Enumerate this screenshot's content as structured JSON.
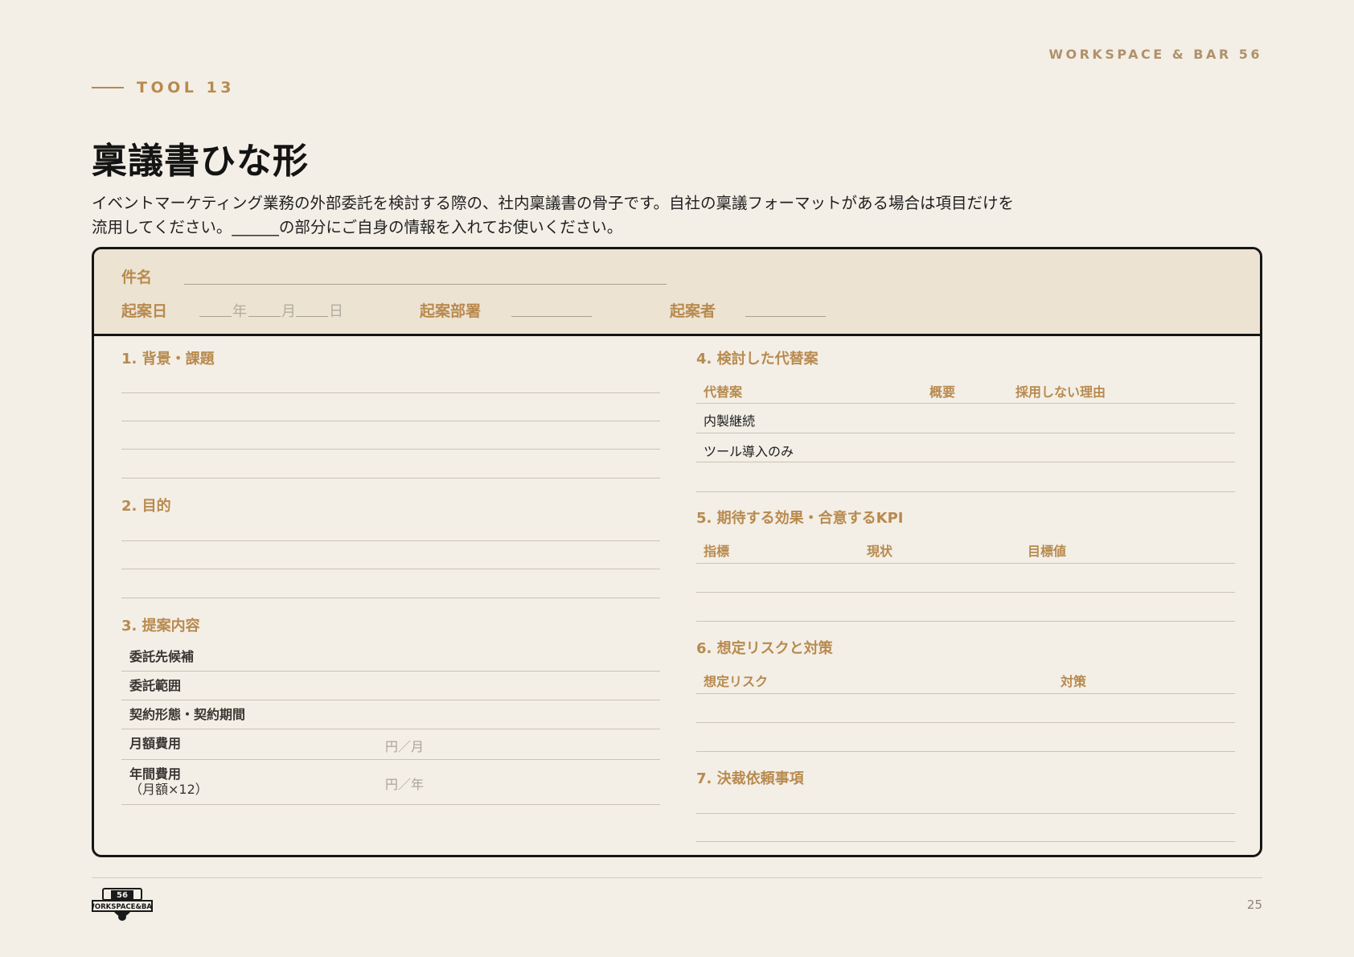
{
  "header": {
    "brand": "WORKSPACE & BAR 56",
    "tool_label": "TOOL 13",
    "title": "稟議書ひな形",
    "intro_line1": "イベントマーケティング業務の外部委託を検討する際の、社内稟議書の骨子です。自社の稟議フォーマットがある場合は項目だけを",
    "intro_line2": "流用してください。______の部分にご自身の情報を入れてお使いください。"
  },
  "form_header": {
    "subject_label": "件名",
    "date_label": "起案日",
    "year": "年",
    "month": "月",
    "day": "日",
    "dept_label": "起案部署",
    "author_label": "起案者"
  },
  "sections": {
    "s1": "1. 背景・課題",
    "s2": "2. 目的",
    "s3": {
      "title": "3. 提案内容",
      "rows": [
        {
          "label": "委託先候補",
          "unit": ""
        },
        {
          "label": "委託範囲",
          "unit": ""
        },
        {
          "label": "契約形態・契約期間",
          "unit": ""
        },
        {
          "label": "月額費用",
          "unit": "円／月"
        },
        {
          "label": "年間費用",
          "label2": "（月額×12）",
          "unit": "円／年"
        }
      ]
    },
    "s4": {
      "title": "4. 検討した代替案",
      "headers": [
        "代替案",
        "概要",
        "採用しない理由"
      ],
      "rows": [
        "内製継続",
        "ツール導入のみ",
        ""
      ]
    },
    "s5": {
      "title": "5. 期待する効果・合意するKPI",
      "headers": [
        "指標",
        "現状",
        "目標値"
      ]
    },
    "s6": {
      "title": "6. 想定リスクと対策",
      "headers": [
        "想定リスク",
        "対策"
      ]
    },
    "s7": "7. 決裁依頼事項"
  },
  "footer": {
    "logo_text": "WORKSPACE&BAR",
    "logo_num": "56",
    "page_number": "25"
  },
  "colors": {
    "accent": "#b88a4e",
    "background": "#f3efe7",
    "header_band": "#ece3d3",
    "border": "#161616"
  }
}
